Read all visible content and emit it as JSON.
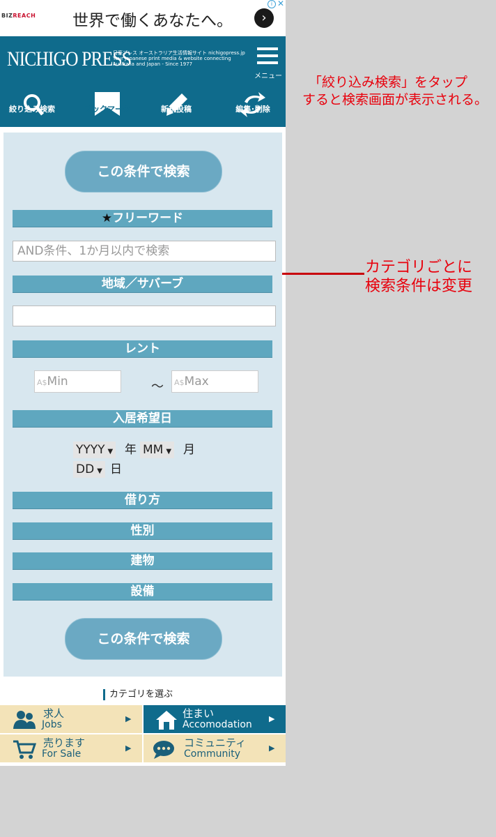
{
  "ad": {
    "logo_part1": "BIZ",
    "logo_part2": "REACH",
    "text": "世界で働くあなたへ。",
    "arrow": "›",
    "info": "i",
    "close": "✕"
  },
  "header": {
    "logo": "NICHIGO PRESS",
    "tagline": "日豪プレス オーストラリア生活情報サイト nichigopress.jp Your Japanese print media & website connecting Australia and Japan - Since 1977",
    "menu_label": "メニュー",
    "nav": [
      {
        "label": "絞り込み検索",
        "icon": "search-icon"
      },
      {
        "label": "ブックマーク",
        "icon": "bookmark-icon"
      },
      {
        "label": "新規投稿",
        "icon": "pencil-icon"
      },
      {
        "label": "編集･削除",
        "icon": "arrows-icon"
      }
    ]
  },
  "search_form": {
    "submit_label": "この条件で検索",
    "free_word_label": "フリーワード",
    "free_word_placeholder": "AND条件、1か月以内で検索",
    "area_label": "地域／サバーブ",
    "rent_label": "レント",
    "rent_currency": "A$",
    "rent_min_placeholder": "Min",
    "rent_max_placeholder": "Max",
    "rent_separator": "～",
    "move_in_label": "入居希望日",
    "year_value": "YYYY",
    "year_unit": "年",
    "month_value": "MM",
    "month_unit": "月",
    "day_value": "DD",
    "day_unit": "日",
    "sections": [
      "借り方",
      "性別",
      "建物",
      "設備"
    ]
  },
  "categories": {
    "heading": "カテゴリを選ぶ",
    "items": [
      {
        "jp": "求人",
        "en": "Jobs",
        "icon": "people-icon"
      },
      {
        "jp": "住まい",
        "en": "Accomodation",
        "icon": "house-icon"
      },
      {
        "jp": "売ります",
        "en": "For Sale",
        "icon": "cart-icon"
      },
      {
        "jp": "コミュニティ",
        "en": "Community",
        "icon": "chat-icon"
      }
    ]
  },
  "annotations": {
    "tap_note_line1": "「絞り込み検索」をタップ",
    "tap_note_line2": "すると検索画面が表示される。",
    "category_note_line1": "カテゴリごとに",
    "category_note_line2": "検索条件は変更"
  },
  "colors": {
    "header": "#0f6b8c",
    "section_bar": "#5fa7bf",
    "panel": "#d8e7ef",
    "annotation": "#e8000c"
  }
}
